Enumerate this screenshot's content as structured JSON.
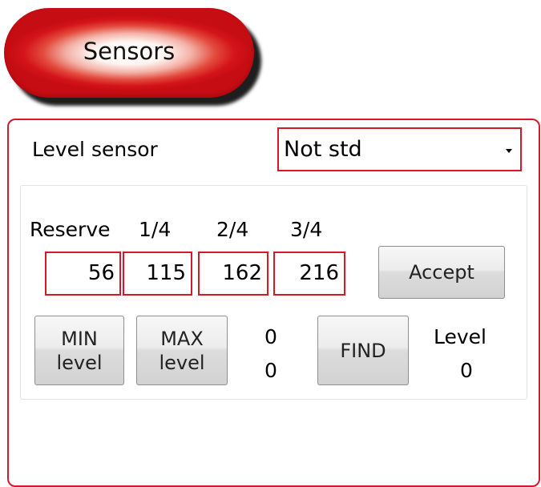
{
  "header": {
    "title": "Sensors"
  },
  "level_sensor": {
    "label": "Level sensor",
    "selected": "Not std"
  },
  "levels": {
    "labels": [
      "Reserve",
      "1/4",
      "2/4",
      "3/4"
    ],
    "values": [
      "56",
      "115",
      "162",
      "216"
    ]
  },
  "buttons": {
    "accept": "Accept",
    "min_line1": "MIN",
    "min_line2": "level",
    "max_line1": "MAX",
    "max_line2": "level",
    "find": "FIND"
  },
  "readouts": {
    "min_value": "0",
    "max_value": "0",
    "level_label": "Level",
    "level_value": "0"
  },
  "colors": {
    "accent": "#d41a2a"
  }
}
